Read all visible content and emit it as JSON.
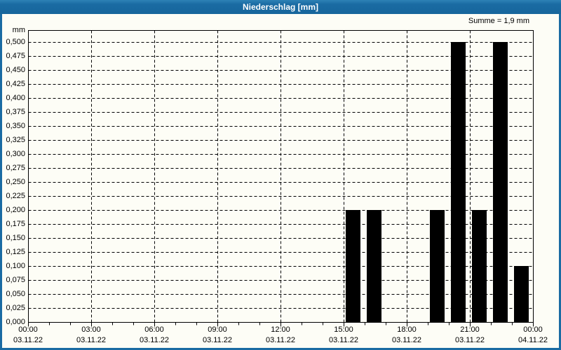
{
  "window": {
    "title": "Niederschlag [mm]"
  },
  "annotations": {
    "sum": "Summe = 1,9 mm"
  },
  "colors": {
    "titlebar": "#1a6ba3",
    "frame": "#1a6ba3",
    "title_text": "#ffffff",
    "background": "#fdfdf6",
    "bar": "#000000",
    "grid": "#000000",
    "axis": "#000000",
    "text": "#000000"
  },
  "chart_data": {
    "type": "bar",
    "title": "Niederschlag [mm]",
    "ylabel": "mm",
    "sum_annotation": "Summe = 1,9 mm",
    "y_min": 0,
    "y_max": 0.5,
    "y_step": 0.025,
    "y_tick_labels": [
      "0,000",
      "0,025",
      "0,050",
      "0,075",
      "0,100",
      "0,125",
      "0,150",
      "0,175",
      "0,200",
      "0,225",
      "0,250",
      "0,275",
      "0,300",
      "0,325",
      "0,350",
      "0,375",
      "0,400",
      "0,425",
      "0,450",
      "0,475",
      "0,500"
    ],
    "x_axis": {
      "hours_span": 24,
      "major_tick_every_hours": 3,
      "minor_tick_every_hours": 1,
      "grid": "dashed"
    },
    "x_tick_labels": [
      {
        "time": "00:00",
        "date": "03.11.22"
      },
      {
        "time": "03:00",
        "date": "03.11.22"
      },
      {
        "time": "06:00",
        "date": "03.11.22"
      },
      {
        "time": "09:00",
        "date": "03.11.22"
      },
      {
        "time": "12:00",
        "date": "03.11.22"
      },
      {
        "time": "15:00",
        "date": "03.11.22"
      },
      {
        "time": "18:00",
        "date": "03.11.22"
      },
      {
        "time": "21:00",
        "date": "03.11.22"
      },
      {
        "time": "00:00",
        "date": "04.11.22"
      }
    ],
    "series": [
      {
        "name": "Niederschlag",
        "unit": "mm",
        "hour_start_values": [
          0,
          0,
          0,
          0,
          0,
          0,
          0,
          0,
          0,
          0,
          0,
          0,
          0,
          0,
          0,
          0.2,
          0.2,
          0,
          0,
          0.2,
          0.5,
          0.2,
          0.5,
          0.1
        ]
      }
    ],
    "sum_value_mm": 1.9
  }
}
